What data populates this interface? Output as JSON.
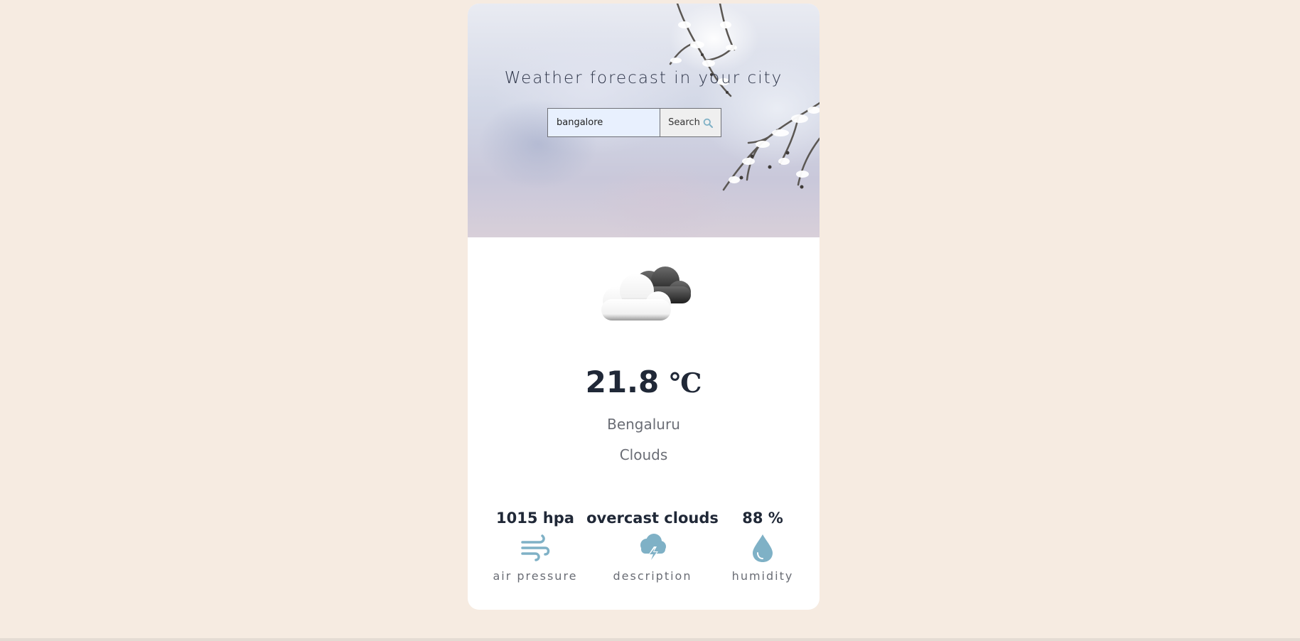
{
  "header": {
    "title": "Weather forecast in your city"
  },
  "search": {
    "value": "bangalore",
    "button_label": "Search",
    "button_icon": "search-icon"
  },
  "current": {
    "icon": "cloud-icon",
    "temperature": "21.8",
    "unit": "℃",
    "city": "Bengaluru",
    "condition": "Clouds"
  },
  "stats": {
    "pressure": {
      "value": "1015 hpa",
      "label": "air pressure",
      "icon": "wind-icon"
    },
    "description": {
      "value": "overcast clouds",
      "label": "description",
      "icon": "storm-cloud-icon"
    },
    "humidity": {
      "value": "88 %",
      "label": "humidity",
      "icon": "drop-icon"
    }
  },
  "colors": {
    "page_background": "#f6ebe1",
    "card_background": "#ffffff",
    "accent": "#7fb1c6",
    "text_dark": "#202837",
    "text_muted": "#6a6d75"
  }
}
